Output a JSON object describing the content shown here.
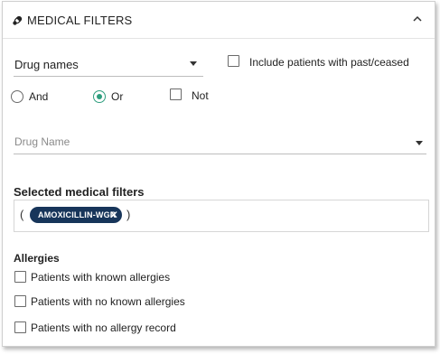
{
  "header": {
    "title": "MEDICAL FILTERS",
    "icon": "pills-icon",
    "collapse_icon": "chevron-up-icon"
  },
  "drug_names_select": {
    "value": "Drug names"
  },
  "include_past_checkbox": {
    "label": "Include patients with past/ceased",
    "checked": false
  },
  "logic": {
    "options": [
      {
        "label": "And",
        "selected": false
      },
      {
        "label": "Or",
        "selected": true
      }
    ],
    "not_label": "Not",
    "not_checked": false
  },
  "drug_name_select": {
    "placeholder": "Drug Name"
  },
  "selected_filters": {
    "title": "Selected medical filters",
    "open_paren": "(",
    "close_paren": ")",
    "chips": [
      {
        "label": "AMOXICILLIN-WGR",
        "remove_symbol": "✕"
      }
    ]
  },
  "allergies": {
    "title": "Allergies",
    "options": [
      {
        "label": "Patients with known allergies",
        "checked": false
      },
      {
        "label": "Patients with no known allergies",
        "checked": false
      },
      {
        "label": "Patients with no allergy record",
        "checked": false
      }
    ]
  },
  "colors": {
    "accent_green": "#2e9e7e",
    "chip_navy": "#17355a"
  }
}
